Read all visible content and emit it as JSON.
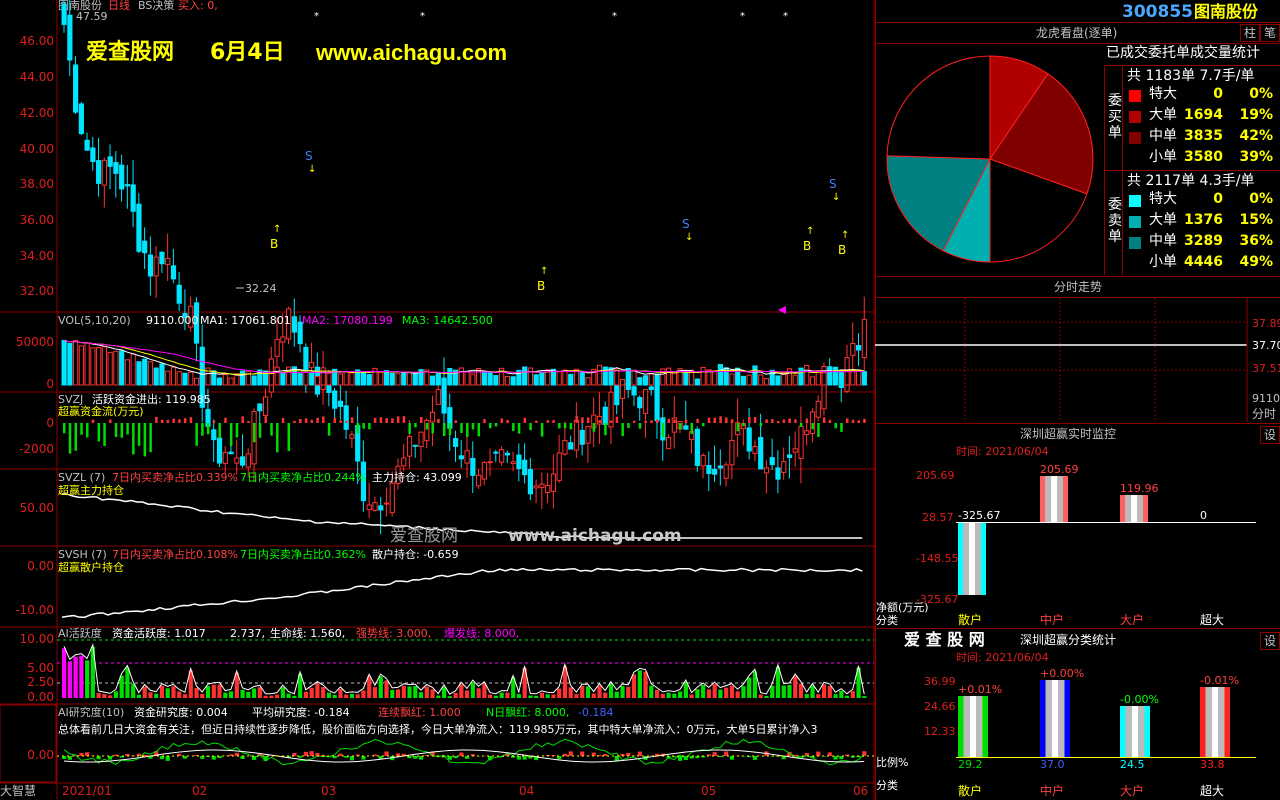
{
  "colors": {
    "up": "#ff3232",
    "down": "#00e5ff",
    "grid": "#8b0000",
    "yellow": "#ffff00",
    "white": "#ffffff",
    "green": "#00dd00",
    "magenta": "#ff00ff",
    "cyan": "#00ffff"
  },
  "main": {
    "header": {
      "name": "图南股份",
      "period": "日线",
      "indicator": "BS决策",
      "buy": "买入: 0,"
    },
    "watermark": {
      "site": "爱查股网",
      "date": "6月4日",
      "url": "www.aichagu.com"
    },
    "high_label": "47.59",
    "low_label": "32.24",
    "y_ticks": [
      "46.00",
      "44.00",
      "42.00",
      "40.00",
      "38.00",
      "36.00",
      "34.00",
      "32.00"
    ],
    "signals": {
      "buy": "B",
      "sell": "S"
    },
    "trend": [
      46.5,
      44.2,
      42.8,
      42.3,
      42.5,
      41.8,
      40.5,
      39.6,
      40.2,
      39.1,
      38.5,
      36.2,
      34.4,
      34.6,
      34.1,
      35.0,
      36.1,
      37.8,
      38.3,
      37.6,
      36.4,
      36.3,
      35.8,
      34.8,
      33.4,
      33.1,
      33.6,
      34.1,
      34.8,
      35.4,
      36.0,
      35.1,
      34.4,
      34.1,
      33.9,
      34.2,
      34.0,
      33.8,
      33.7,
      33.9,
      34.6,
      35.0,
      35.4,
      35.6,
      35.8,
      36.2,
      36.1,
      35.9,
      35.2,
      35.3,
      34.9,
      34.1,
      34.3,
      34.6,
      35.1,
      34.8,
      34.3,
      34.1,
      34.6,
      35.0,
      36.1,
      37.0,
      36.5,
      37.6,
      38.0
    ]
  },
  "vol": {
    "label": "VOL(5,10,20)",
    "val": "9110.000",
    "ma1": "MA1: 17061.801",
    "ma2": "MA2: 17080.199",
    "ma3": "MA3: 14642.500",
    "y_ticks": [
      "50000",
      "0"
    ]
  },
  "svzj": {
    "label": "SVZJ",
    "desc": "活跃资金进出: 119.985",
    "name": "超赢资金流(万元)",
    "y_ticks": [
      "0",
      "-2000"
    ]
  },
  "svzl": {
    "label": "SVZL (7)",
    "a": "7日内买卖净占比0.339%",
    "b": "7日内买卖净占比0.244%",
    "c": "主力持仓: 43.099",
    "name": "超赢主力持仓",
    "y_ticks": [
      "50.00"
    ]
  },
  "svsh": {
    "label": "SVSH (7)",
    "a": "7日内买卖净占比0.108%",
    "b": "7日内买卖净占比0.362%",
    "c": "散户持仓: -0.659",
    "name": "超赢散户持仓",
    "y_ticks": [
      "0.00",
      "-10.00"
    ]
  },
  "ai1": {
    "label": "AI活跃度",
    "a": "资金活跃度: 1.017",
    "b": "2.737,",
    "c": "生命线: 1.560,",
    "d": "强势线: 3.000,",
    "e": "爆发线: 8.000,",
    "y_ticks": [
      "10.00",
      "5.00",
      "2.50",
      "0.00"
    ]
  },
  "ai2": {
    "label": "AI研究度(10)",
    "a": "资金研究度: 0.004",
    "b": "平均研究度: -0.184",
    "c": "连续飘红: 1.000",
    "d": "N日飘红: 8.000,",
    "e": "-0.184",
    "comment": "总体看前几日大资金有关注，但近日持续性逐步降低，股价面临方向选择，今日大单净流入：119.985万元，其中特大单净流入：0万元，大单5日累计净入3",
    "y_ticks": [
      "0.00"
    ]
  },
  "xaxis": {
    "left": "大智慧",
    "labels": [
      "2021/01",
      "02",
      "03",
      "04",
      "05",
      "06"
    ]
  },
  "right": {
    "code": "300855",
    "name": "图南股份",
    "btn1": "柱",
    "btn2": "笔",
    "lhk": {
      "title": "龙虎看盘(逐单)",
      "stat": "已成交委托单成交量统计",
      "buy": {
        "side": "委买单",
        "total": "共 1183单 7.7手/单",
        "rows": [
          {
            "label": "特大",
            "count": "0",
            "pct": "0%",
            "color": "#ff0000"
          },
          {
            "label": "大单",
            "count": "1694",
            "pct": "19%",
            "color": "#b00000"
          },
          {
            "label": "中单",
            "count": "3835",
            "pct": "42%",
            "color": "#800000"
          },
          {
            "label": "小单",
            "count": "3580",
            "pct": "39%",
            "color": "#000000"
          }
        ]
      },
      "sell": {
        "side": "委卖单",
        "total": "共 2117单 4.3手/单",
        "rows": [
          {
            "label": "特大",
            "count": "0",
            "pct": "0%",
            "color": "#00ffff"
          },
          {
            "label": "大单",
            "count": "1376",
            "pct": "15%",
            "color": "#00b0b0"
          },
          {
            "label": "中单",
            "count": "3289",
            "pct": "36%",
            "color": "#008080"
          },
          {
            "label": "小单",
            "count": "4446",
            "pct": "49%",
            "color": "#000000"
          }
        ]
      },
      "pie": [
        {
          "pct": 19,
          "color": "#b00000"
        },
        {
          "pct": 42,
          "color": "#800000"
        },
        {
          "pct": 39,
          "color": "#000000"
        },
        {
          "pct": 15,
          "color": "#00b0b0"
        },
        {
          "pct": 36,
          "color": "#008080"
        },
        {
          "pct": 49,
          "color": "#000000"
        }
      ]
    },
    "fenshi": {
      "title": "分时走势",
      "y": [
        "37.89",
        "37.70",
        "37.51",
        "9110"
      ],
      "tail": "分时"
    },
    "rt": {
      "title": "深圳超赢实时监控",
      "btn": "设",
      "time": "时间: 2021/06/04",
      "y": [
        "205.69",
        "28.57",
        "-148.55",
        "-325.67"
      ],
      "unit": "净额(万元)",
      "cat_label": "分类",
      "cats": [
        "散户",
        "中户",
        "大户",
        "超大"
      ],
      "values": [
        -325.67,
        205.69,
        119.96,
        0
      ],
      "val_labels": [
        "-325.67",
        "205.69",
        "119.96",
        "0"
      ]
    },
    "cls": {
      "title": "深圳超赢分类统计",
      "btn": "设",
      "brand": "爱 查 股 网",
      "time": "时间: 2021/06/04",
      "y": [
        "36.99",
        "24.66",
        "12.33"
      ],
      "pct_label": "比例%",
      "cat_label": "分类",
      "cats": [
        "散户",
        "中户",
        "大户",
        "超大"
      ],
      "values": [
        29.2,
        37.0,
        24.5,
        33.8
      ],
      "val_labels": [
        "29.2",
        "37.0",
        "24.5",
        "33.8"
      ],
      "chg": [
        "+0.01%",
        "+0.00%",
        "-0.00%",
        "-0.01%"
      ],
      "colors": [
        "#00dd00",
        "#0000ff",
        "#00ffff",
        "#ff2020"
      ]
    }
  },
  "chart_data": [
    {
      "type": "bar",
      "title": "深圳超赢实时监控",
      "categories": [
        "散户",
        "中户",
        "大户",
        "超大"
      ],
      "values": [
        -325.67,
        205.69,
        119.96,
        0
      ],
      "ylabel": "净额(万元)"
    },
    {
      "type": "bar",
      "title": "深圳超赢分类统计",
      "categories": [
        "散户",
        "中户",
        "大户",
        "超大"
      ],
      "values": [
        29.2,
        37.0,
        24.5,
        33.8
      ],
      "ylabel": "比例%"
    },
    {
      "type": "pie",
      "title": "龙虎看盘(逐单)",
      "categories": [
        "大单",
        "中单",
        "小单",
        "大单",
        "中单",
        "小单"
      ],
      "values": [
        19,
        42,
        39,
        15,
        36,
        49
      ]
    }
  ]
}
